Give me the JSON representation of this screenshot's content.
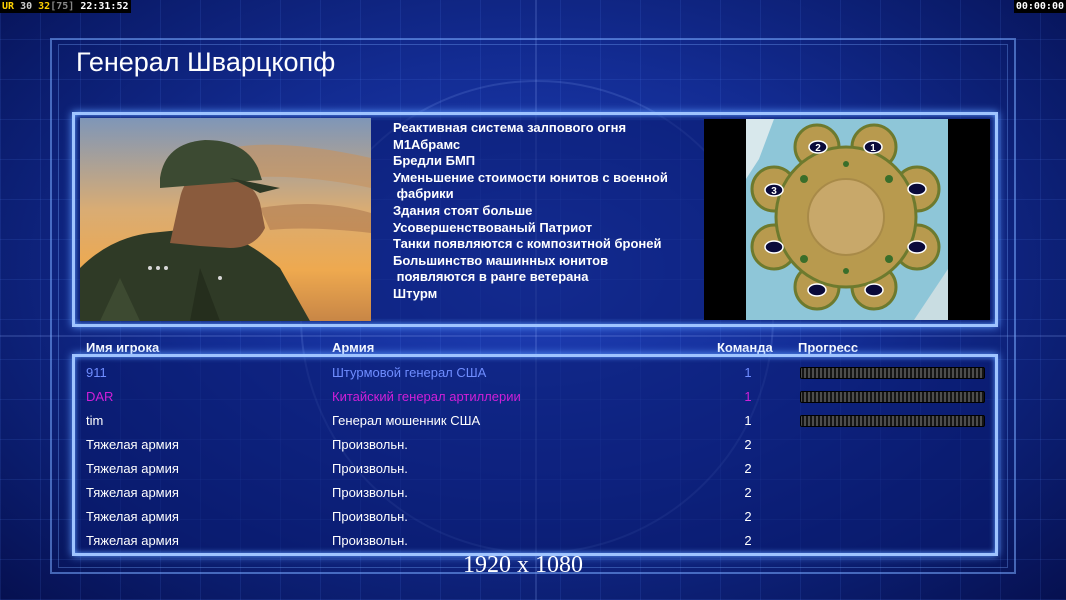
{
  "hud": {
    "left": {
      "tag": "UR",
      "fps": "30",
      "limit": "32",
      "bracket": "[75]",
      "clock": "22:31:52"
    },
    "right_clock": "00:00:00"
  },
  "general": {
    "name": "Генерал Шварцкопф",
    "bonuses": [
      "Реактивная система залпового огня",
      "М1Абрамс",
      "Бредли БМП",
      "Уменьшение стоимости юнитов с военной",
      " фабрики",
      "Здания стоят больше",
      "Усовершенствованый Патриот",
      "Танки появляются с композитной броней",
      "Большинство машинных юнитов",
      " появляются в ранге ветерана",
      "Штурм"
    ]
  },
  "map": {
    "start_positions": [
      "1",
      "2",
      "3"
    ]
  },
  "table": {
    "headers": {
      "player": "Имя игрока",
      "army": "Армия",
      "team": "Команда",
      "progress": "Прогресс"
    },
    "rows": [
      {
        "name": "911",
        "army": "Штурмовой генерал США",
        "team": "1",
        "color": "#6f8dff",
        "show_progress": true
      },
      {
        "name": "DAR",
        "army": "Китайский генерал артиллерии",
        "team": "1",
        "color": "#d01fd8",
        "show_progress": true
      },
      {
        "name": "tim",
        "army": "Генерал мошенник США",
        "team": "1",
        "color": "#ffffff",
        "show_progress": true
      },
      {
        "name": "Тяжелая армия",
        "army": "Произвольн.",
        "team": "2",
        "color": "#ffffff",
        "show_progress": false
      },
      {
        "name": "Тяжелая армия",
        "army": "Произвольн.",
        "team": "2",
        "color": "#ffffff",
        "show_progress": false
      },
      {
        "name": "Тяжелая армия",
        "army": "Произвольн.",
        "team": "2",
        "color": "#ffffff",
        "show_progress": false
      },
      {
        "name": "Тяжелая армия",
        "army": "Произвольн.",
        "team": "2",
        "color": "#ffffff",
        "show_progress": false
      },
      {
        "name": "Тяжелая армия",
        "army": "Произвольн.",
        "team": "2",
        "color": "#ffffff",
        "show_progress": false
      }
    ]
  },
  "overlay": {
    "resolution": "1920 x 1080"
  },
  "colors": {
    "panel_border": "#9fc4ff",
    "background": "#132c93",
    "fps_highlight": "#ffd200"
  }
}
